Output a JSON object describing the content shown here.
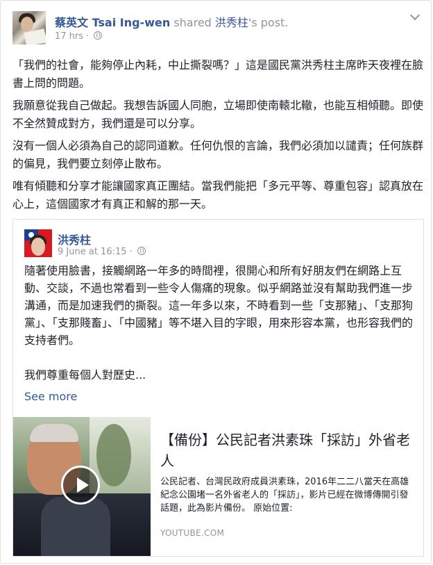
{
  "post": {
    "author_zh": "蔡英文",
    "author_en": "Tsai Ing-wen",
    "shared_word": "shared",
    "shared_target": "洪秀柱",
    "post_suffix": "'s post.",
    "time": "17 hrs",
    "separator": "·",
    "paragraphs": [
      "「我們的社會，能夠停止內耗，中止撕裂嗎？」這是國民黨洪秀柱主席昨天夜裡在臉書上問的問題。",
      "我願意從我自己做起。我想告訴國人同胞，立場即使南轅北轍，也能互相傾聽。即使不全然贊成對方，我們還是可以分享。",
      "沒有一個人必須為自己的認同道歉。任何仇恨的言論，我們必須加以譴責；任何族群的偏見，我們要立刻停止散布。",
      "唯有傾聽和分享才能讓國家真正團結。當我們能把「多元平等、尊重包容」認真放在心上，這個國家才有真正和解的那一天。"
    ]
  },
  "shared_post": {
    "author": "洪秀柱",
    "time": "9 June at 16:15",
    "separator": "·",
    "paragraph1": "隨著使用臉書，接觸網路一年多的時間裡，很開心和所有好朋友們在網路上互動、交談，不過也常看到一些令人傷痛的現象。似乎網路並沒有幫助我們進一步溝通，而是加速我們的撕裂。這一年多以來，不時看到一些「支那豬」、「支那狗黨」、「支那賤畜」、「中國豬」等不堪入目的字眼，用來形容本黨，也形容我們的支持者們。",
    "paragraph2": "我們尊重每個人對歷史...",
    "see_more": "See more"
  },
  "link_preview": {
    "title": "【備份】公民記者洪素珠「採訪」外省老人",
    "description": "公民記者、台灣民政府成員洪素珠，2016年二二八當天在高雄紀念公園堵一名外省老人的「採訪」，影片已經在微博傳開引發話題，此為影片備份。 原始位置:",
    "domain": "YOUTUBE.COM"
  }
}
